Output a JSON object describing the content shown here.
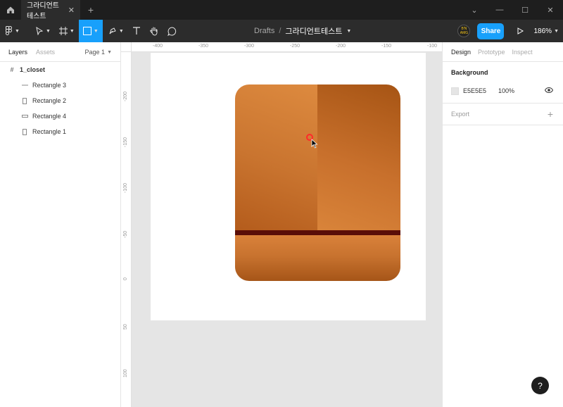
{
  "tab": {
    "title": "그라디언트테스트"
  },
  "breadcrumb": {
    "folder": "Drafts",
    "separator": "/",
    "file": "그라디언트테스트"
  },
  "toolbar": {
    "share": "Share",
    "zoom": "186%",
    "avatar_text": "B'N\nAMG"
  },
  "left_panel": {
    "tabs": [
      "Layers",
      "Assets"
    ],
    "page": "Page 1",
    "frame": "1_closet",
    "layers": [
      "Rectangle 3",
      "Rectangle 2",
      "Rectangle 4",
      "Rectangle 1"
    ]
  },
  "right_panel": {
    "tabs": [
      "Design",
      "Prototype",
      "Inspect"
    ],
    "background_title": "Background",
    "bg_hex": "E5E5E5",
    "bg_opacity": "100%",
    "export_title": "Export"
  },
  "ruler": {
    "top": [
      "-400",
      "-350",
      "-300",
      "-250",
      "-200",
      "-150",
      "-100"
    ],
    "left": [
      "-200",
      "-150",
      "-100",
      "-50",
      "0",
      "50",
      "100"
    ]
  },
  "help": "?",
  "colors": {
    "accent": "#18a0fb",
    "closet_divider": "#5a0e08",
    "closet_wood": "#d9843a",
    "cursor_target": "#ff2a2a"
  },
  "icons": [
    "home-icon",
    "close-icon",
    "add-tab-icon",
    "minimize-icon",
    "maximize-icon",
    "window-close-icon",
    "main-menu-icon",
    "move-tool-icon",
    "frame-tool-icon",
    "rectangle-tool-icon",
    "pen-tool-icon",
    "text-tool-icon",
    "hand-tool-icon",
    "comment-tool-icon",
    "play-icon",
    "eye-icon",
    "plus-icon"
  ]
}
